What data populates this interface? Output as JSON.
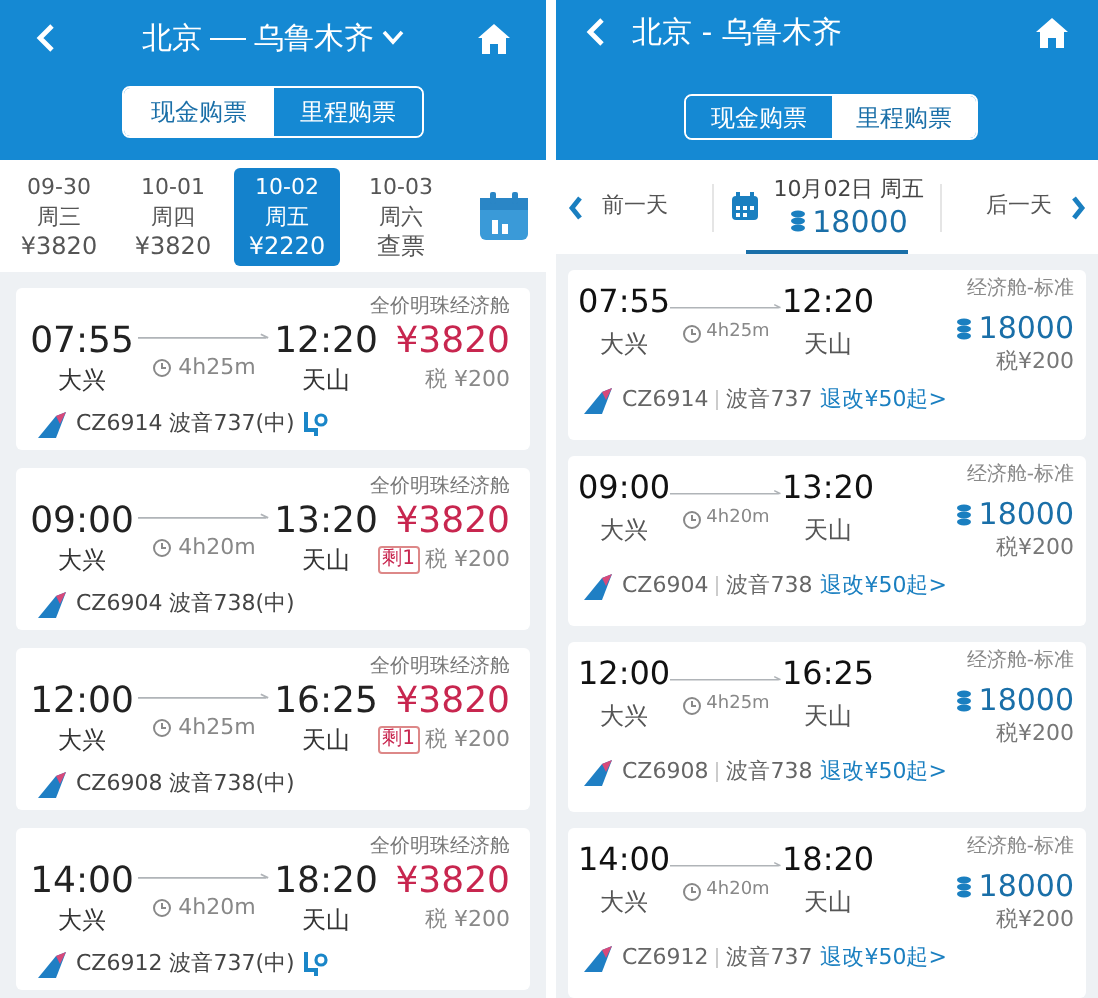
{
  "left_screen": {
    "title_from": "北京",
    "title_to": "乌鲁木齐",
    "purchase_tabs": [
      {
        "label": "现金购票",
        "selected": true
      },
      {
        "label": "里程购票",
        "selected": false
      }
    ],
    "dates": [
      {
        "date": "09-30",
        "weekday": "周三",
        "price": "¥3820",
        "selected": false
      },
      {
        "date": "10-01",
        "weekday": "周四",
        "price": "¥3820",
        "selected": false
      },
      {
        "date": "10-02",
        "weekday": "周五",
        "price": "¥2220",
        "selected": true
      },
      {
        "date": "10-03",
        "weekday": "周六",
        "price": "查票",
        "selected": false
      }
    ],
    "flights": [
      {
        "cabin": "全价明珠经济舱",
        "departure_time": "07:55",
        "departure_airport": "大兴",
        "duration": "4h25m",
        "arrival_time": "12:20",
        "arrival_airport": "天山",
        "price": "¥3820",
        "tax": "税 ¥200",
        "flight": "CZ6914 波音737(中)",
        "seat_icon": true
      },
      {
        "cabin": "全价明珠经济舱",
        "departure_time": "09:00",
        "departure_airport": "大兴",
        "duration": "4h20m",
        "arrival_time": "13:20",
        "arrival_airport": "天山",
        "price": "¥3820",
        "remaining": "剩1",
        "tax": "税 ¥200",
        "flight": "CZ6904 波音738(中)",
        "seat_icon": false
      },
      {
        "cabin": "全价明珠经济舱",
        "departure_time": "12:00",
        "departure_airport": "大兴",
        "duration": "4h25m",
        "arrival_time": "16:25",
        "arrival_airport": "天山",
        "price": "¥3820",
        "remaining": "剩1",
        "tax": "税 ¥200",
        "flight": "CZ6908 波音738(中)",
        "seat_icon": false
      },
      {
        "cabin": "全价明珠经济舱",
        "departure_time": "14:00",
        "departure_airport": "大兴",
        "duration": "4h20m",
        "arrival_time": "18:20",
        "arrival_airport": "天山",
        "price": "¥3820",
        "tax": "税 ¥200",
        "flight": "CZ6912 波音737(中)",
        "seat_icon": true
      }
    ]
  },
  "right_screen": {
    "title": "北京 - 乌鲁木齐",
    "purchase_tabs": [
      {
        "label": "现金购票",
        "selected": false
      },
      {
        "label": "里程购票",
        "selected": true
      }
    ],
    "date_bar": {
      "previous": "前一天",
      "date": "10月02日 周五",
      "miles": "18000",
      "next": "后一天"
    },
    "flights": [
      {
        "cabin": "经济舱-标准",
        "departure_time": "07:55",
        "departure_airport": "大兴",
        "duration": "4h25m",
        "arrival_time": "12:20",
        "arrival_airport": "天山",
        "miles": "18000",
        "tax": "税¥200",
        "flight_number": "CZ6914",
        "aircraft": "波音737",
        "change_fee": "退改¥50起>"
      },
      {
        "cabin": "经济舱-标准",
        "departure_time": "09:00",
        "departure_airport": "大兴",
        "duration": "4h20m",
        "arrival_time": "13:20",
        "arrival_airport": "天山",
        "miles": "18000",
        "tax": "税¥200",
        "flight_number": "CZ6904",
        "aircraft": "波音738",
        "change_fee": "退改¥50起>"
      },
      {
        "cabin": "经济舱-标准",
        "departure_time": "12:00",
        "departure_airport": "大兴",
        "duration": "4h25m",
        "arrival_time": "16:25",
        "arrival_airport": "天山",
        "miles": "18000",
        "tax": "税¥200",
        "flight_number": "CZ6908",
        "aircraft": "波音738",
        "change_fee": "退改¥50起>"
      },
      {
        "cabin": "经济舱-标准",
        "departure_time": "14:00",
        "departure_airport": "大兴",
        "duration": "4h20m",
        "arrival_time": "18:20",
        "arrival_airport": "天山",
        "miles": "18000",
        "tax": "税¥200",
        "flight_number": "CZ6912",
        "aircraft": "波音737",
        "change_fee": "退改¥50起>"
      }
    ]
  }
}
